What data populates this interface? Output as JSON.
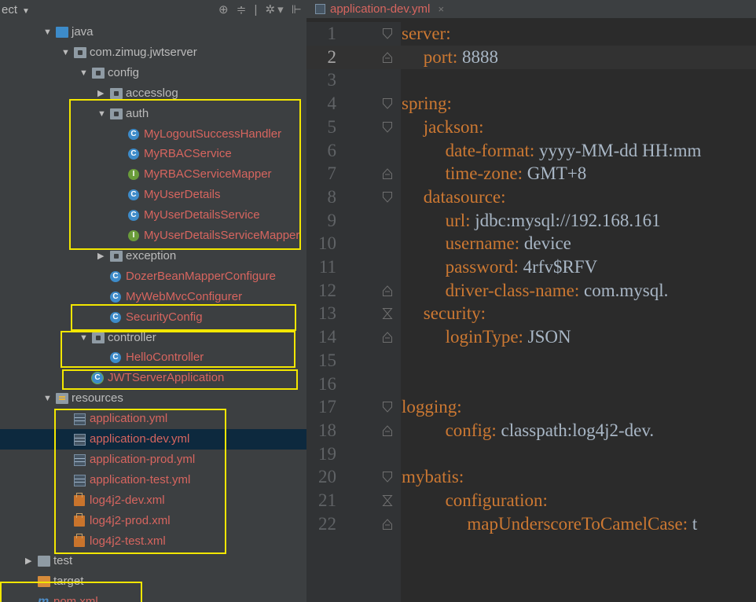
{
  "project_panel": {
    "title": "ect",
    "tools": "⊕ ≑ | ✲▾ ⊩",
    "tree": [
      {
        "label": "java",
        "indent": 1,
        "arrow": "down",
        "icon": "folder-blue",
        "style": "plain"
      },
      {
        "label": "com.zimug.jwtserver",
        "indent": 2,
        "arrow": "down",
        "icon": "package",
        "style": "plain"
      },
      {
        "label": "config",
        "indent": 3,
        "arrow": "down",
        "icon": "package",
        "style": "plain"
      },
      {
        "label": "accesslog",
        "indent": 4,
        "arrow": "right",
        "icon": "package",
        "style": "plain"
      },
      {
        "label": "auth",
        "indent": 4,
        "arrow": "down",
        "icon": "package",
        "style": "plain"
      },
      {
        "label": "MyLogoutSuccessHandler",
        "indent": 5,
        "arrow": "",
        "icon": "class",
        "style": "red"
      },
      {
        "label": "MyRBACService",
        "indent": 5,
        "arrow": "",
        "icon": "class",
        "style": "red"
      },
      {
        "label": "MyRBACServiceMapper",
        "indent": 5,
        "arrow": "",
        "icon": "interface",
        "style": "red"
      },
      {
        "label": "MyUserDetails",
        "indent": 5,
        "arrow": "",
        "icon": "class",
        "style": "red"
      },
      {
        "label": "MyUserDetailsService",
        "indent": 5,
        "arrow": "",
        "icon": "class",
        "style": "red"
      },
      {
        "label": "MyUserDetailsServiceMapper",
        "indent": 5,
        "arrow": "",
        "icon": "interface",
        "style": "red"
      },
      {
        "label": "exception",
        "indent": 4,
        "arrow": "right",
        "icon": "package",
        "style": "plain"
      },
      {
        "label": "DozerBeanMapperConfigure",
        "indent": 4,
        "arrow": "",
        "icon": "class",
        "style": "red"
      },
      {
        "label": "MyWebMvcConfigurer",
        "indent": 4,
        "arrow": "",
        "icon": "class",
        "style": "red"
      },
      {
        "label": "SecurityConfig",
        "indent": 4,
        "arrow": "",
        "icon": "class",
        "style": "red"
      },
      {
        "label": "controller",
        "indent": 3,
        "arrow": "down",
        "icon": "package",
        "style": "plain"
      },
      {
        "label": "HelloController",
        "indent": 4,
        "arrow": "",
        "icon": "class",
        "style": "red"
      },
      {
        "label": "JWTServerApplication",
        "indent": 3,
        "arrow": "",
        "icon": "spring-class",
        "style": "red"
      },
      {
        "label": "resources",
        "indent": 1,
        "arrow": "down",
        "icon": "folder-res",
        "style": "plain"
      },
      {
        "label": "application.yml",
        "indent": 2,
        "arrow": "",
        "icon": "yml",
        "style": "red"
      },
      {
        "label": "application-dev.yml",
        "indent": 2,
        "arrow": "",
        "icon": "yml",
        "style": "red",
        "selected": true
      },
      {
        "label": "application-prod.yml",
        "indent": 2,
        "arrow": "",
        "icon": "yml",
        "style": "red"
      },
      {
        "label": "application-test.yml",
        "indent": 2,
        "arrow": "",
        "icon": "yml",
        "style": "red"
      },
      {
        "label": "log4j2-dev.xml",
        "indent": 2,
        "arrow": "",
        "icon": "xml",
        "style": "red"
      },
      {
        "label": "log4j2-prod.xml",
        "indent": 2,
        "arrow": "",
        "icon": "xml",
        "style": "red"
      },
      {
        "label": "log4j2-test.xml",
        "indent": 2,
        "arrow": "",
        "icon": "xml",
        "style": "red"
      },
      {
        "label": "test",
        "indent": 0,
        "arrow": "right",
        "icon": "folder",
        "style": "plain"
      },
      {
        "label": "target",
        "indent": 0,
        "arrow": "",
        "icon": "folder-orange",
        "style": "plain"
      },
      {
        "label": "pom.xml",
        "indent": 0,
        "arrow": "",
        "icon": "maven",
        "style": "red"
      }
    ]
  },
  "editor": {
    "tab_label": "application-dev.yml",
    "tab_close": "×",
    "current_line": 2,
    "lines": [
      {
        "n": "1",
        "indent": 0,
        "key": "server",
        "sep": ":",
        "value": "",
        "fold": "open"
      },
      {
        "n": "2",
        "indent": 1,
        "key": "port",
        "sep": ": ",
        "value": "8888",
        "fold": "end"
      },
      {
        "n": "3",
        "indent": 0,
        "key": "",
        "sep": "",
        "value": "",
        "fold": ""
      },
      {
        "n": "4",
        "indent": 0,
        "key": "spring",
        "sep": ":",
        "value": "",
        "fold": "open"
      },
      {
        "n": "5",
        "indent": 1,
        "key": "jackson",
        "sep": ":",
        "value": "",
        "fold": "open"
      },
      {
        "n": "6",
        "indent": 2,
        "key": "date-format",
        "sep": ": ",
        "value": "yyyy-MM-dd HH:mm",
        "fold": ""
      },
      {
        "n": "7",
        "indent": 2,
        "key": "time-zone",
        "sep": ": ",
        "value": "GMT+8",
        "fold": "end"
      },
      {
        "n": "8",
        "indent": 1,
        "key": "datasource",
        "sep": ":",
        "value": "",
        "fold": "open"
      },
      {
        "n": "9",
        "indent": 2,
        "key": "url",
        "sep": ": ",
        "value": "jdbc:mysql://192.168.161",
        "fold": ""
      },
      {
        "n": "10",
        "indent": 2,
        "key": "username",
        "sep": ": ",
        "value": "device",
        "fold": ""
      },
      {
        "n": "11",
        "indent": 2,
        "key": "password",
        "sep": ": ",
        "value": "4rfv$RFV",
        "fold": ""
      },
      {
        "n": "12",
        "indent": 2,
        "key": "driver-class-name",
        "sep": ": ",
        "value": "com.mysql.",
        "fold": "end"
      },
      {
        "n": "13",
        "indent": 1,
        "key": "security",
        "sep": ":",
        "value": "",
        "fold": "both"
      },
      {
        "n": "14",
        "indent": 2,
        "key": "loginType",
        "sep": ": ",
        "value": "JSON",
        "fold": "end"
      },
      {
        "n": "15",
        "indent": 0,
        "key": "",
        "sep": "",
        "value": "",
        "fold": ""
      },
      {
        "n": "16",
        "indent": 0,
        "key": "",
        "sep": "",
        "value": "",
        "fold": ""
      },
      {
        "n": "17",
        "indent": 0,
        "key": "logging",
        "sep": ":",
        "value": "",
        "fold": "open"
      },
      {
        "n": "18",
        "indent": 2,
        "key": "config",
        "sep": ": ",
        "value": "classpath:log4j2-dev.",
        "fold": "end"
      },
      {
        "n": "19",
        "indent": 0,
        "key": "",
        "sep": "",
        "value": "",
        "fold": ""
      },
      {
        "n": "20",
        "indent": 0,
        "key": "mybatis",
        "sep": ":",
        "value": "",
        "fold": "open"
      },
      {
        "n": "21",
        "indent": 2,
        "key": "configuration",
        "sep": ":",
        "value": "",
        "fold": "both"
      },
      {
        "n": "22",
        "indent": 3,
        "key": "mapUnderscoreToCamelCase",
        "sep": ": ",
        "value": "t",
        "fold": "end"
      }
    ]
  },
  "colors": {
    "panel_bg": "#3c3f41",
    "editor_bg": "#2b2b2b",
    "key": "#cc7832",
    "value": "#a9b7c6",
    "vcs_new_file": "#d7655f",
    "highlight_box": "#f2e600"
  }
}
